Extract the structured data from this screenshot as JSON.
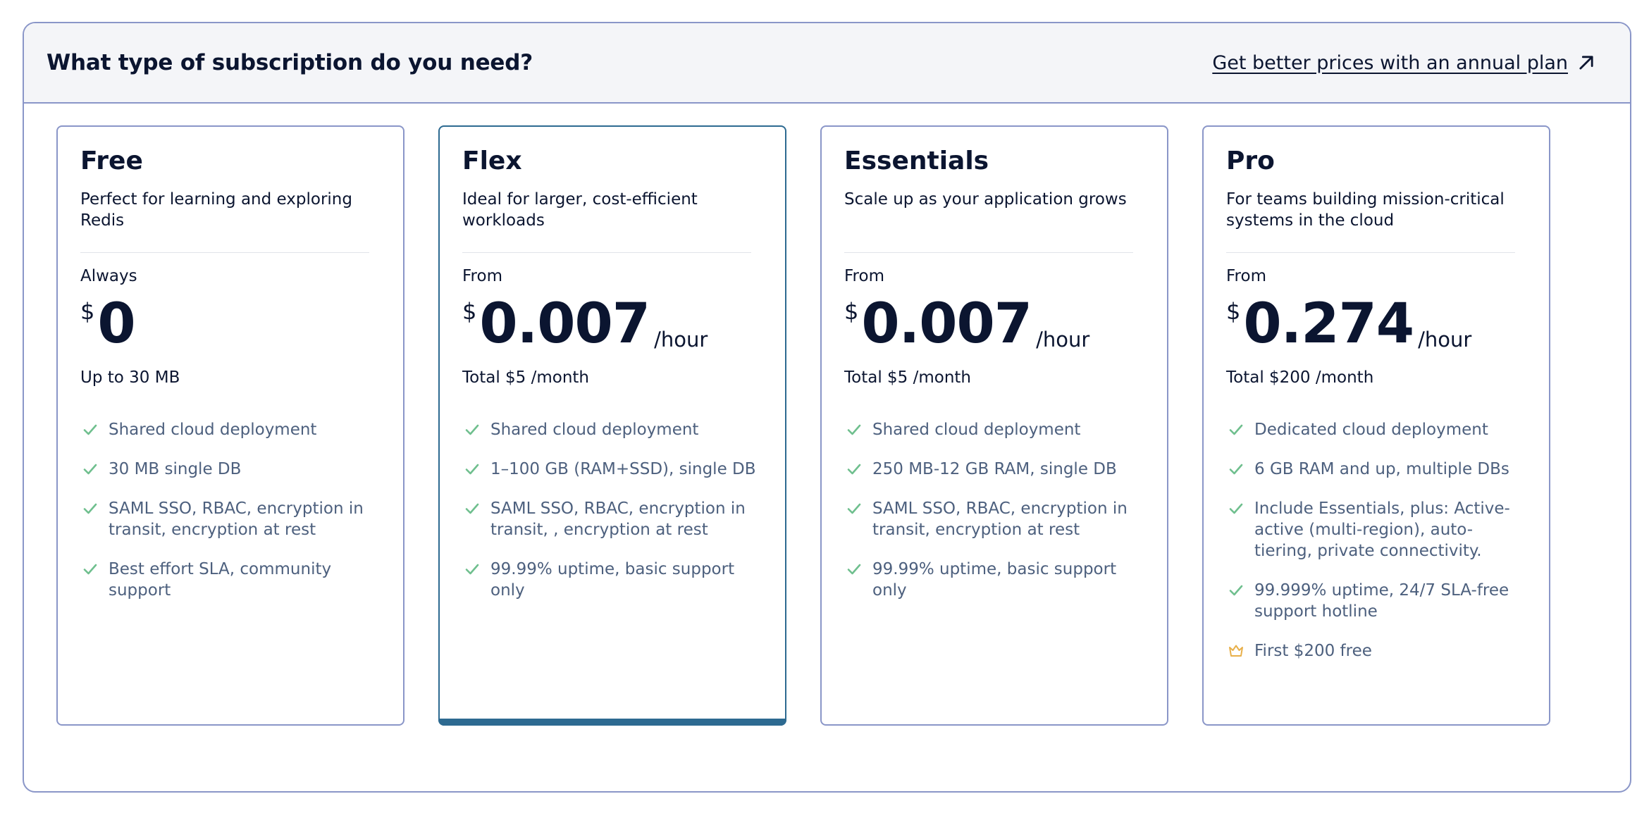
{
  "header": {
    "title": "What type of subscription do you need?",
    "annual_link": "Get better prices with an annual plan",
    "annual_link_icon": "arrow-up-right-icon"
  },
  "colors": {
    "border": "#8a96c8",
    "selected": "#2d6a91",
    "check": "#6fbf8e",
    "crown": "#e8b04a",
    "feature_text": "#4d607e"
  },
  "plans": [
    {
      "name": "Free",
      "description": "Perfect for learning and exploring Redis",
      "price_prefix": "Always",
      "currency": "$",
      "amount": "0",
      "unit": "",
      "total": "Up to 30 MB",
      "selected": false,
      "features": [
        {
          "icon": "check-icon",
          "text": "Shared cloud deployment"
        },
        {
          "icon": "check-icon",
          "text": "30 MB single DB"
        },
        {
          "icon": "check-icon",
          "text": "SAML SSO, RBAC, encryption in transit, encryption at rest"
        },
        {
          "icon": "check-icon",
          "text": "Best effort SLA, community support"
        }
      ]
    },
    {
      "name": "Flex",
      "description": "Ideal for larger, cost-efficient workloads",
      "price_prefix": "From",
      "currency": "$",
      "amount": "0.007",
      "unit": "/hour",
      "total": "Total $5 /month",
      "selected": true,
      "features": [
        {
          "icon": "check-icon",
          "text": "Shared cloud deployment"
        },
        {
          "icon": "check-icon",
          "text": "1–100 GB (RAM+SSD), single DB"
        },
        {
          "icon": "check-icon",
          "text": "SAML SSO, RBAC, encryption in transit, , encryption at rest"
        },
        {
          "icon": "check-icon",
          "text": "99.99% uptime, basic support only"
        }
      ]
    },
    {
      "name": "Essentials",
      "description": "Scale up as your application grows",
      "price_prefix": "From",
      "currency": "$",
      "amount": "0.007",
      "unit": "/hour",
      "total": "Total $5 /month",
      "selected": false,
      "features": [
        {
          "icon": "check-icon",
          "text": "Shared cloud deployment"
        },
        {
          "icon": "check-icon",
          "text": "250 MB-12 GB RAM, single DB"
        },
        {
          "icon": "check-icon",
          "text": "SAML SSO, RBAC, encryption in transit, encryption at rest"
        },
        {
          "icon": "check-icon",
          "text": "99.99% uptime, basic support only"
        }
      ]
    },
    {
      "name": "Pro",
      "description": "For teams building mission-critical systems in the cloud",
      "price_prefix": "From",
      "currency": "$",
      "amount": "0.274",
      "unit": "/hour",
      "total": "Total $200 /month",
      "selected": false,
      "features": [
        {
          "icon": "check-icon",
          "text": "Dedicated cloud deployment"
        },
        {
          "icon": "check-icon",
          "text": "6 GB RAM and up, multiple DBs"
        },
        {
          "icon": "check-icon",
          "text": "Include Essentials, plus: Active-active (multi-region), auto-tiering, private connectivity."
        },
        {
          "icon": "check-icon",
          "text": "99.999% uptime, 24/7 SLA-free support hotline"
        },
        {
          "icon": "crown-icon",
          "text": "First $200 free"
        }
      ]
    }
  ]
}
